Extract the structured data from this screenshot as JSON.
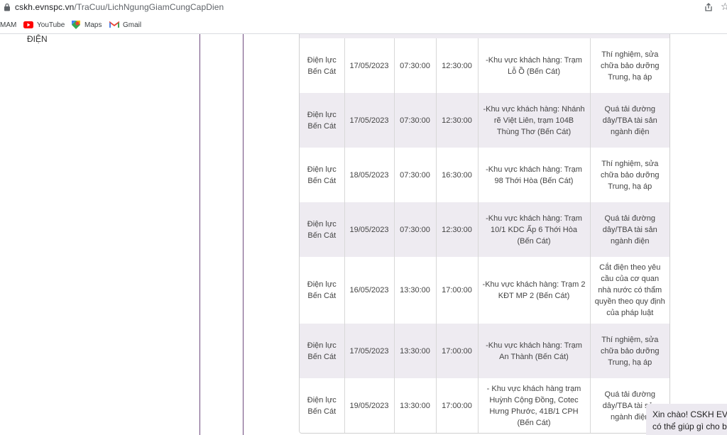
{
  "browser": {
    "url_host": "cskh.evnspc.vn",
    "url_path": "/TraCuu/LichNgungGiamCungCapDien",
    "bookmarks": [
      "MAM",
      "YouTube",
      "Maps",
      "Gmail"
    ]
  },
  "page": {
    "left_heading": "ĐIỆN"
  },
  "rows": [
    {
      "unit": "Điện lực Bến Cát",
      "date": "17/05/2023",
      "start": "07:30:00",
      "end": "12:30:00",
      "area": "-Khu vực khách hàng: Trạm Lỗ Ồ (Bến Cát)",
      "reason": "Thí nghiệm, sửa chữa bảo dưỡng Trung, hạ áp"
    },
    {
      "unit": "Điện lực Bến Cát",
      "date": "17/05/2023",
      "start": "07:30:00",
      "end": "12:30:00",
      "area": "-Khu vực khách hàng: Nhánh rẽ Việt Liên, trạm 104B Thùng Thơ (Bến Cát)",
      "reason": "Quá tải đường dây/TBA tài sản ngành điện"
    },
    {
      "unit": "Điện lực Bến Cát",
      "date": "18/05/2023",
      "start": "07:30:00",
      "end": "16:30:00",
      "area": "-Khu vực khách hàng: Trạm 98 Thới Hòa (Bến Cát)",
      "reason": "Thí nghiệm, sửa chữa bảo dưỡng Trung, hạ áp"
    },
    {
      "unit": "Điện lực Bến Cát",
      "date": "19/05/2023",
      "start": "07:30:00",
      "end": "12:30:00",
      "area": "-Khu vực khách hàng: Trạm 10/1 KDC Ấp 6 Thới Hòa (Bến Cát)",
      "reason": "Quá tải đường dây/TBA tài sản ngành điện"
    },
    {
      "unit": "Điện lực Bến Cát",
      "date": "16/05/2023",
      "start": "13:30:00",
      "end": "17:00:00",
      "area": "-Khu vực khách hàng: Trạm 2 KĐT MP 2 (Bến Cát)",
      "reason": "Cắt điện theo yêu cầu của cơ quan nhà nước có thẩm quyền theo quy định của pháp luật"
    },
    {
      "unit": "Điện lực Bến Cát",
      "date": "17/05/2023",
      "start": "13:30:00",
      "end": "17:00:00",
      "area": "-Khu vực khách hàng: Trạm An Thành (Bến Cát)",
      "reason": "Thí nghiệm, sửa chữa bảo dưỡng Trung, hạ áp"
    },
    {
      "unit": "Điện lực Bến Cát",
      "date": "19/05/2023",
      "start": "13:30:00",
      "end": "17:00:00",
      "area": "- Khu vực khách hàng trạm Huỳnh Cộng Đồng, Cotec Hưng Phước, 41B/1 CPH (Bến Cát)",
      "reason": "Quá tải đường dây/TBA tài sản ngành điện"
    }
  ],
  "chat": {
    "line1": "Xin chào! CSKH EVN",
    "line2": "có thể giúp gì cho bạn"
  }
}
